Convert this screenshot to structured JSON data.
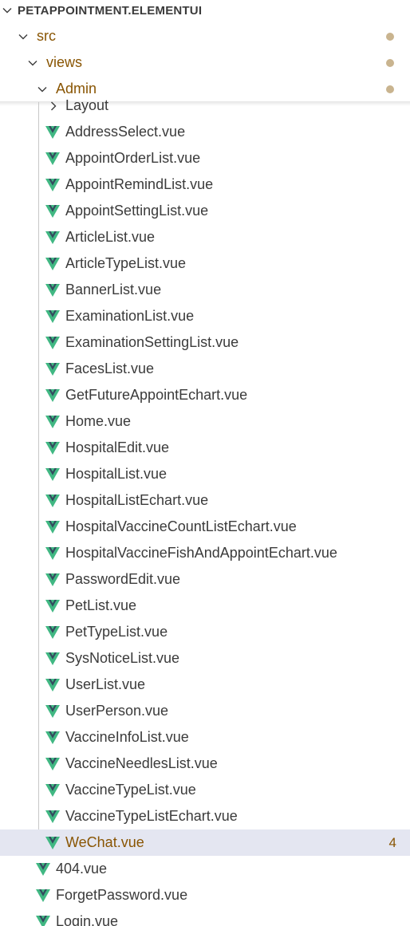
{
  "explorer": {
    "root": {
      "label": "PETAPPOINTMENT.ELEMENTUI",
      "icon": "chevron-down-icon"
    },
    "folders": [
      {
        "label": "src",
        "icon": "chevron-down-icon",
        "status": "modified-dot"
      },
      {
        "label": "views",
        "icon": "chevron-down-icon",
        "status": "modified-dot"
      },
      {
        "label": "Admin",
        "icon": "chevron-down-icon",
        "status": "modified-dot"
      },
      {
        "label": "Layout",
        "icon": "chevron-right-icon"
      }
    ],
    "admin_files": [
      "AddressSelect.vue",
      "AppointOrderList.vue",
      "AppointRemindList.vue",
      "AppointSettingList.vue",
      "ArticleList.vue",
      "ArticleTypeList.vue",
      "BannerList.vue",
      "ExaminationList.vue",
      "ExaminationSettingList.vue",
      "FacesList.vue",
      "GetFutureAppointEchart.vue",
      "Home.vue",
      "HospitalEdit.vue",
      "HospitalList.vue",
      "HospitalListEchart.vue",
      "HospitalVaccineCountListEchart.vue",
      "HospitalVaccineFishAndAppointEchart.vue",
      "PasswordEdit.vue",
      "PetList.vue",
      "PetTypeList.vue",
      "SysNoticeList.vue",
      "UserList.vue",
      "UserPerson.vue",
      "VaccineInfoList.vue",
      "VaccineNeedlesList.vue",
      "VaccineTypeList.vue",
      "VaccineTypeListEchart.vue"
    ],
    "selected_file": {
      "label": "WeChat.vue",
      "badge": "4"
    },
    "views_files": [
      "404.vue",
      "ForgetPassword.vue",
      "Login.vue"
    ],
    "colors": {
      "folder_text": "#895503",
      "file_text": "#3b3b3b",
      "vue_green": "#41b883",
      "vue_dark": "#34495e",
      "selected_bg": "#e4e6f1",
      "dot": "#c9b48f"
    }
  }
}
